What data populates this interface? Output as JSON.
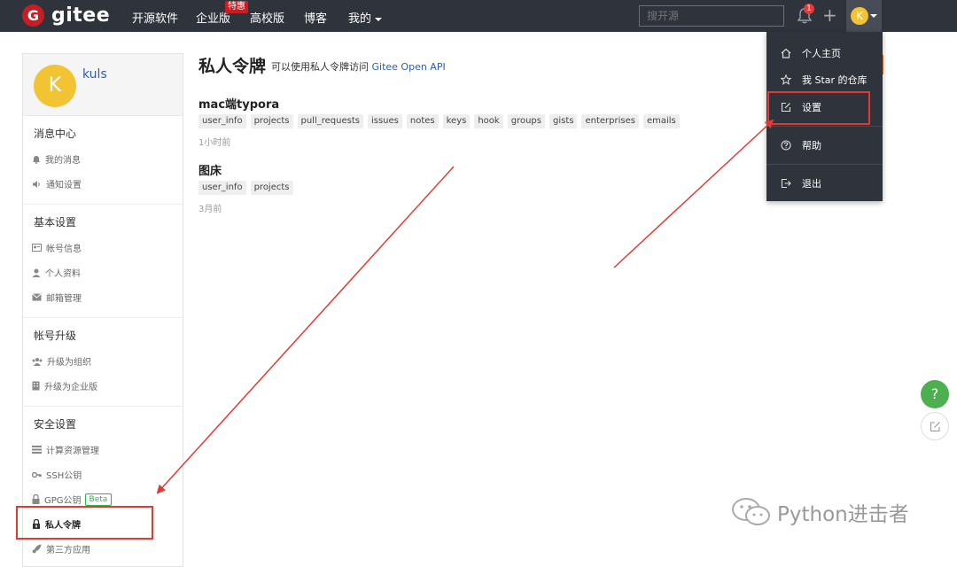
{
  "topbar": {
    "logo_letter": "G",
    "logo_text": "gitee",
    "nav": [
      "开源软件",
      "企业版",
      "高校版",
      "博客",
      "我的"
    ],
    "enterprise_badge": "特惠",
    "search_placeholder": "搜开源",
    "notification_count": "1",
    "avatar_letter": "K"
  },
  "sidebar": {
    "avatar_letter": "K",
    "username": "kuls",
    "sections": [
      {
        "title": "消息中心",
        "items": [
          "我的消息",
          "通知设置"
        ]
      },
      {
        "title": "基本设置",
        "items": [
          "帐号信息",
          "个人资料",
          "邮箱管理"
        ]
      },
      {
        "title": "帐号升级",
        "items": [
          "升级为组织",
          "升级为企业版"
        ]
      },
      {
        "title": "安全设置",
        "items": [
          "计算资源管理",
          "SSH公钥",
          "GPG公钥",
          "私人令牌",
          "第三方应用"
        ]
      }
    ],
    "beta_label": "Beta"
  },
  "main": {
    "title": "私人令牌",
    "subtitle_prefix": "可以使用私人令牌访问",
    "subtitle_api": "Gitee Open API",
    "tokens": [
      {
        "name": "mac端typora",
        "scopes": [
          "user_info",
          "projects",
          "pull_requests",
          "issues",
          "notes",
          "keys",
          "hook",
          "groups",
          "gists",
          "enterprises",
          "emails"
        ],
        "time": "1小时前"
      },
      {
        "name": "图床",
        "scopes": [
          "user_info",
          "projects"
        ],
        "time": "3月前"
      }
    ]
  },
  "dropdown": {
    "items": [
      "个人主页",
      "我 Star 的仓库",
      "设置",
      "帮助",
      "退出"
    ]
  },
  "floating": {
    "help": "?"
  },
  "watermark": "Python进击者",
  "colors": {
    "topbar": "#2f333b",
    "accent_red": "#c71d23",
    "annotation_red": "#e03b33",
    "link_blue": "#2c5db3",
    "help_green": "#4caf50",
    "avatar_yellow": "#f2c433"
  }
}
